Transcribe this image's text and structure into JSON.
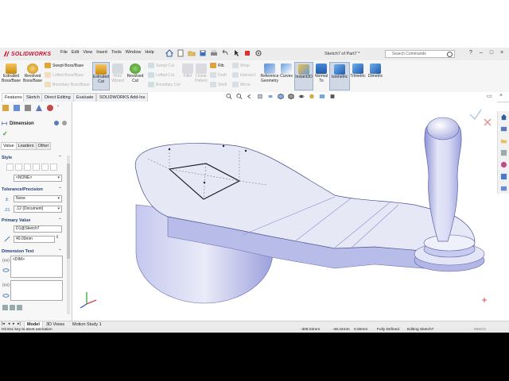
{
  "app": {
    "logo_text": "SOLIDWORKS",
    "document_title": "Sketch7 of Part7 *",
    "search_placeholder": "Search Commands"
  },
  "menu": [
    "File",
    "Edit",
    "View",
    "Insert",
    "Tools",
    "Window",
    "Help"
  ],
  "window_controls": [
    "?",
    "–",
    "□",
    "×"
  ],
  "ribbon": {
    "extruded_boss": "Extruded Boss/Base",
    "revolved_boss": "Revolved Boss/Base",
    "swept_boss": "Swept Boss/Base",
    "lofted_boss": "Lofted Boss/Base",
    "boundary_boss": "Boundary Boss/Base",
    "extruded_cut": "Extruded Cut",
    "hole_wizard": "Hole Wizard",
    "revolved_cut": "Revolved Cut",
    "swept_cut": "Swept Cut",
    "lofted_cut": "Lofted Cut",
    "boundary_cut": "Boundary Cut",
    "fillet": "Fillet",
    "linear_pattern": "Linear Pattern",
    "rib": "Rib",
    "draft": "Draft",
    "shell": "Shell",
    "wrap": "Wrap",
    "intersect": "Intersect",
    "mirror": "Mirror",
    "reference_geometry": "Reference Geometry",
    "curves": "Curves",
    "instant3d": "Instant3D",
    "normal_to": "Normal To",
    "isometric": "Isometric",
    "trimetric": "Trimetric",
    "dimetric": "Dimetric"
  },
  "command_tabs": [
    "Features",
    "Sketch",
    "Direct Editing",
    "Evaluate",
    "SOLIDWORKS Add-Ins"
  ],
  "property_manager": {
    "title": "Dimension",
    "tabs": [
      "Value",
      "Leaders",
      "Other"
    ],
    "style_label": "Style",
    "style_value": "<NONE>",
    "tolerance_label": "Tolerance/Precision",
    "tolerance_value": "None",
    "precision_value": ".12 (Document)",
    "primary_value_label": "Primary Value",
    "primary_name": "D1@Sketch7",
    "primary_value": "40.00mm",
    "dimension_text_label": "Dimension Text",
    "dimension_text": "<DIM>"
  },
  "bottom_tabs": [
    "Model",
    "3D Views",
    "Motion Study 1"
  ],
  "status": {
    "hint": "Hit Esc key to abort animation",
    "x": "-308.02mm",
    "y": "-49.44mm",
    "z": "0.00mm",
    "state": "Fully Defined",
    "editing": "Editing Sketch7",
    "units": "MMGS"
  },
  "colors": {
    "part_face": "#e6e8f6",
    "part_side": "#b9bde8",
    "part_shadow": "#8a8fcf",
    "accent_red": "#c8102e",
    "accent_blue": "#1f3d7a"
  }
}
